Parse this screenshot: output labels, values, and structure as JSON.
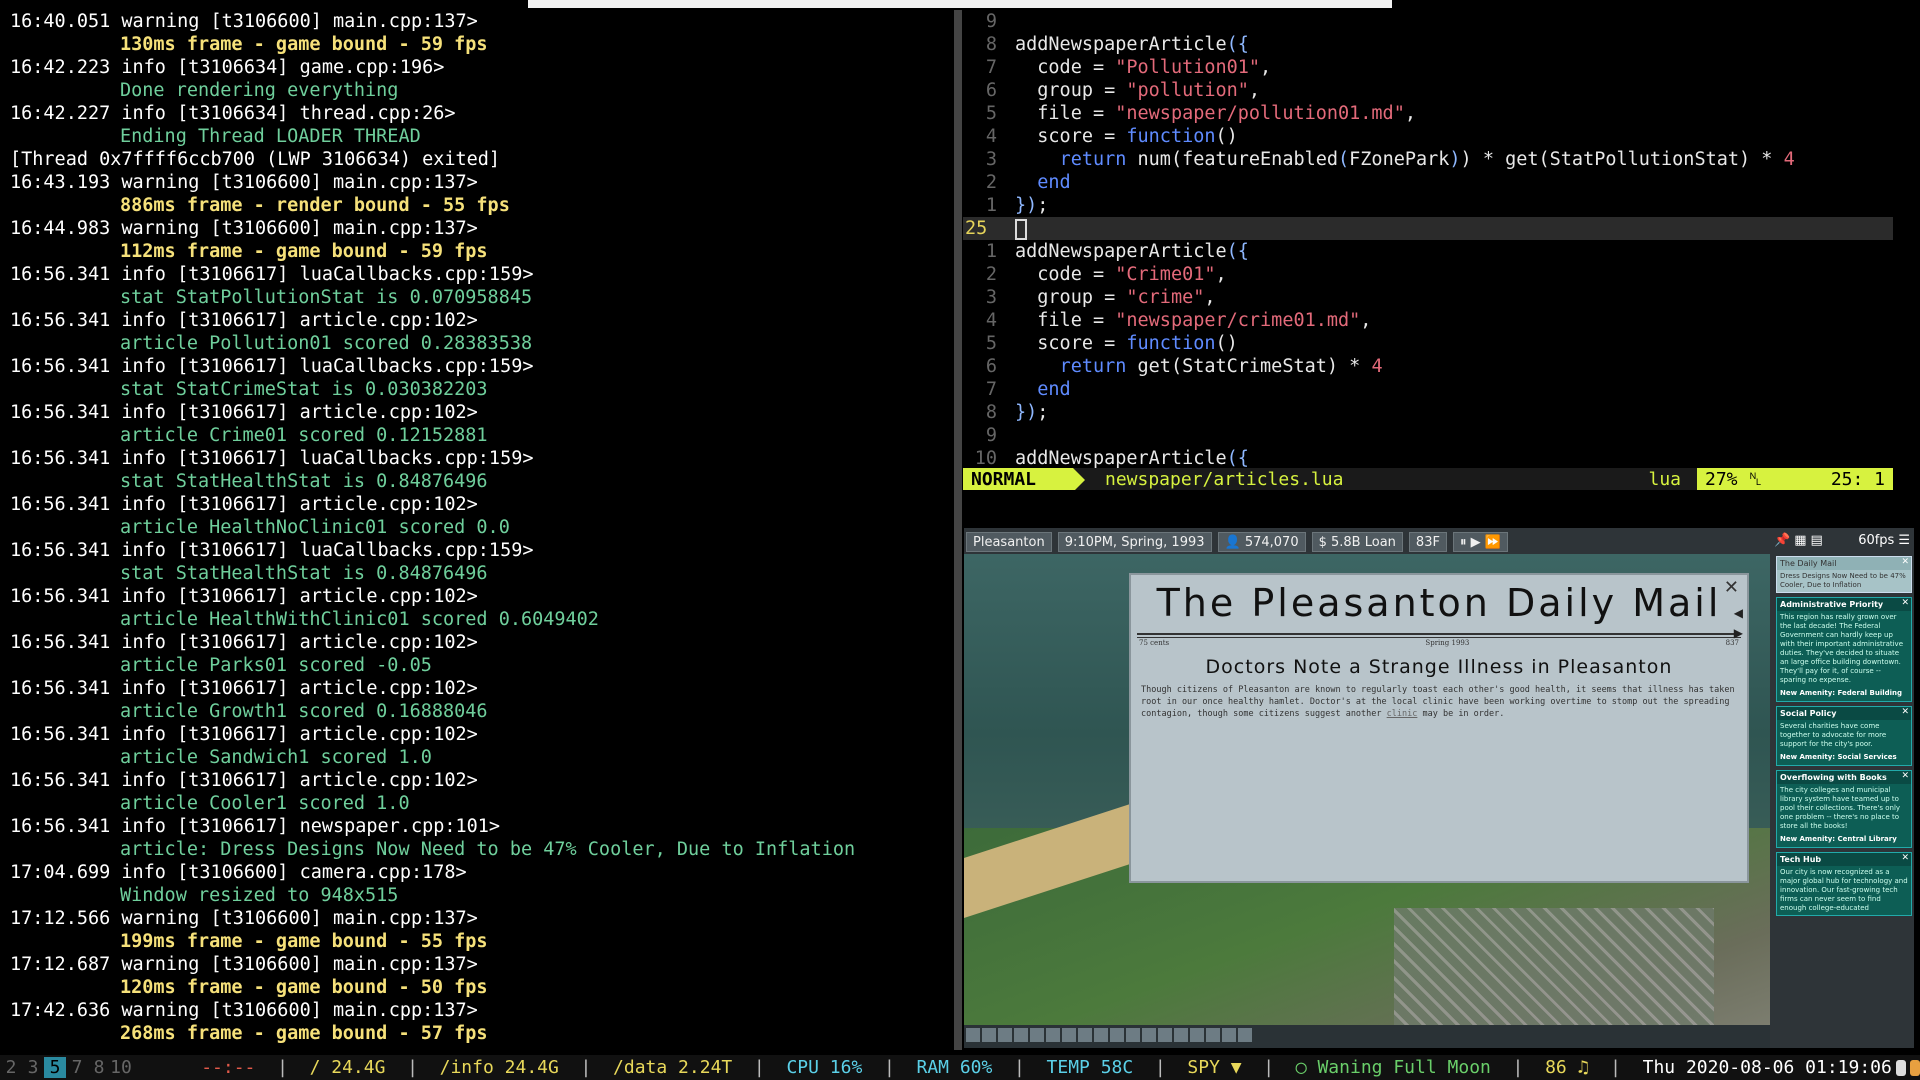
{
  "log": [
    {
      "kind": "head",
      "level": "warning",
      "text": "16:40.051 warning [t3106600] main.cpp:137>"
    },
    {
      "kind": "game",
      "text": "130ms frame - game bound - 59 fps"
    },
    {
      "kind": "head",
      "level": "info",
      "text": "16:42.223 info [t3106634] game.cpp:196>"
    },
    {
      "kind": "plain",
      "text": "Done rendering everything"
    },
    {
      "kind": "head",
      "level": "info",
      "text": "16:42.227 info [t3106634] thread.cpp:26>"
    },
    {
      "kind": "plain",
      "text": "Ending Thread LOADER THREAD"
    },
    {
      "kind": "thread",
      "text": "[Thread 0x7ffff6ccb700 (LWP 3106634) exited]"
    },
    {
      "kind": "head",
      "level": "warning",
      "text": "16:43.193 warning [t3106600] main.cpp:137>"
    },
    {
      "kind": "game",
      "text": "886ms frame - render bound - 55 fps"
    },
    {
      "kind": "head",
      "level": "warning",
      "text": "16:44.983 warning [t3106600] main.cpp:137>"
    },
    {
      "kind": "game",
      "text": "112ms frame - game bound - 59 fps"
    },
    {
      "kind": "head",
      "level": "info",
      "text": "16:56.341 info [t3106617] luaCallbacks.cpp:159>"
    },
    {
      "kind": "plain",
      "text": "stat StatPollutionStat is 0.070958845"
    },
    {
      "kind": "head",
      "level": "info",
      "text": "16:56.341 info [t3106617] article.cpp:102>"
    },
    {
      "kind": "plain",
      "text": "article Pollution01 scored 0.28383538"
    },
    {
      "kind": "head",
      "level": "info",
      "text": "16:56.341 info [t3106617] luaCallbacks.cpp:159>"
    },
    {
      "kind": "plain",
      "text": "stat StatCrimeStat is 0.030382203"
    },
    {
      "kind": "head",
      "level": "info",
      "text": "16:56.341 info [t3106617] article.cpp:102>"
    },
    {
      "kind": "plain",
      "text": "article Crime01 scored 0.12152881"
    },
    {
      "kind": "head",
      "level": "info",
      "text": "16:56.341 info [t3106617] luaCallbacks.cpp:159>"
    },
    {
      "kind": "plain",
      "text": "stat StatHealthStat is 0.84876496"
    },
    {
      "kind": "head",
      "level": "info",
      "text": "16:56.341 info [t3106617] article.cpp:102>"
    },
    {
      "kind": "plain",
      "text": "article HealthNoClinic01 scored 0.0"
    },
    {
      "kind": "head",
      "level": "info",
      "text": "16:56.341 info [t3106617] luaCallbacks.cpp:159>"
    },
    {
      "kind": "plain",
      "text": "stat StatHealthStat is 0.84876496"
    },
    {
      "kind": "head",
      "level": "info",
      "text": "16:56.341 info [t3106617] article.cpp:102>"
    },
    {
      "kind": "plain",
      "text": "article HealthWithClinic01 scored 0.6049402"
    },
    {
      "kind": "head",
      "level": "info",
      "text": "16:56.341 info [t3106617] article.cpp:102>"
    },
    {
      "kind": "plain",
      "text": "article Parks01 scored -0.05"
    },
    {
      "kind": "head",
      "level": "info",
      "text": "16:56.341 info [t3106617] article.cpp:102>"
    },
    {
      "kind": "plain",
      "text": "article Growth1 scored 0.16888046"
    },
    {
      "kind": "head",
      "level": "info",
      "text": "16:56.341 info [t3106617] article.cpp:102>"
    },
    {
      "kind": "plain",
      "text": "article Sandwich1 scored 1.0"
    },
    {
      "kind": "head",
      "level": "info",
      "text": "16:56.341 info [t3106617] article.cpp:102>"
    },
    {
      "kind": "plain",
      "text": "article Cooler1 scored 1.0"
    },
    {
      "kind": "head",
      "level": "info",
      "text": "16:56.341 info [t3106617] newspaper.cpp:101>"
    },
    {
      "kind": "plain",
      "text": "article: Dress Designs Now Need to be 47% Cooler, Due to Inflation"
    },
    {
      "kind": "head",
      "level": "info",
      "text": "17:04.699 info [t3106600] camera.cpp:178>"
    },
    {
      "kind": "plain",
      "text": "Window resized to 948x515"
    },
    {
      "kind": "head",
      "level": "warning",
      "text": "17:12.566 warning [t3106600] main.cpp:137>"
    },
    {
      "kind": "game",
      "text": "199ms frame - game bound - 55 fps"
    },
    {
      "kind": "head",
      "level": "warning",
      "text": "17:12.687 warning [t3106600] main.cpp:137>"
    },
    {
      "kind": "game",
      "text": "120ms frame - game bound - 50 fps"
    },
    {
      "kind": "head",
      "level": "warning",
      "text": "17:42.636 warning [t3106600] main.cpp:137>"
    },
    {
      "kind": "game",
      "text": "268ms frame - game bound - 57 fps"
    }
  ],
  "editor": {
    "lines": [
      {
        "n": "9",
        "html": ""
      },
      {
        "n": "8",
        "html": "addNewspaperArticle<span class='p'>({</span>"
      },
      {
        "n": "7",
        "html": "  code = <span class='s'>\"Pollution01\"</span>,"
      },
      {
        "n": "6",
        "html": "  group = <span class='s'>\"pollution\"</span>,"
      },
      {
        "n": "5",
        "html": "  file = <span class='s'>\"newspaper/pollution01.md\"</span>,"
      },
      {
        "n": "4",
        "html": "  score = <span class='k'>function</span>()"
      },
      {
        "n": "3",
        "html": "    <span class='k'>return</span> num(featureEnabled<span class='p'>(</span>FZonePark<span class='p'>)</span>) * get(StatPollutionStat) * <span class='n'>4</span>"
      },
      {
        "n": "2",
        "html": "  <span class='k'>end</span>"
      },
      {
        "n": "1",
        "html": "<span class='p'>})</span>;"
      },
      {
        "n": "25",
        "html": "<span class='cursorbox'></span>",
        "current": true
      },
      {
        "n": "1",
        "html": "addNewspaperArticle<span class='p'>({</span>"
      },
      {
        "n": "2",
        "html": "  code = <span class='s'>\"Crime01\"</span>,"
      },
      {
        "n": "3",
        "html": "  group = <span class='s'>\"crime\"</span>,"
      },
      {
        "n": "4",
        "html": "  file = <span class='s'>\"newspaper/crime01.md\"</span>,"
      },
      {
        "n": "5",
        "html": "  score = <span class='k'>function</span>()"
      },
      {
        "n": "6",
        "html": "    <span class='k'>return</span> get(StatCrimeStat) * <span class='n'>4</span>"
      },
      {
        "n": "7",
        "html": "  <span class='k'>end</span>"
      },
      {
        "n": "8",
        "html": "<span class='p'>})</span>;"
      },
      {
        "n": "9",
        "html": ""
      },
      {
        "n": "10",
        "html": "addNewspaperArticle<span class='p'>({</span>"
      }
    ],
    "status": {
      "mode": "NORMAL",
      "file": "newspaper/articles.lua",
      "filetype": "lua",
      "percent": "27% ␤",
      "position": "25:  1"
    }
  },
  "game": {
    "city": "Pleasanton",
    "time": "9:10PM, Spring,   1993",
    "population": "574,070",
    "money": "$  5.8B Loan",
    "temp": "83F",
    "fps": "60fps",
    "paper": {
      "masthead": "The Pleasanton Daily Mail",
      "left_date": "75 cents",
      "mid_date": "Spring 1993",
      "right_date": "837",
      "headline": "Doctors Note a Strange Illness in Pleasanton",
      "story": "Though citizens of Pleasanton are known to regularly toast each other's good health, it seems that illness has taken root in our once healthy hamlet. Doctor's at the local clinic have been working overtime to stomp out the spreading contagion, though some citizens suggest another",
      "story_link": "clinic",
      "story_end": " may be in order."
    },
    "sidebar": {
      "fps": "60fps",
      "cards": [
        {
          "title": "The Daily Mail",
          "body": "Dress Designs Now Need to be 47% Cooler, Due to Inflation",
          "foot": "",
          "light": true
        },
        {
          "title": "Administrative Priority",
          "body": "This region has really grown over the last decade! The Federal Government can hardly keep up with their important administrative duties. They've decided to situate an large office building downtown. They'll pay for it, of course -- sparing no expense.",
          "foot": "New Amenity: Federal Building",
          "light": false
        },
        {
          "title": "Social Policy",
          "body": "Several charities have come together to advocate for more support for the city's poor.",
          "foot": "New Amenity: Social Services",
          "light": false
        },
        {
          "title": "Overflowing with Books",
          "body": "The city colleges and municipal library system have teamed up to pool their collections. There's only one problem -- there's no place to store all the books!",
          "foot": "New Amenity: Central Library",
          "light": false
        },
        {
          "title": "Tech Hub",
          "body": "Our city is now recognized as a major global hub for technology and innovation. Our fast-growing tech firms can never seem to find enough college-educated",
          "foot": "",
          "light": false
        }
      ]
    }
  },
  "statusbar": {
    "workspaces": [
      "2",
      "3",
      "5",
      "7",
      "8",
      "10"
    ],
    "active": "5",
    "time_sep": "--:--",
    "disk_root": "/ 24.4G",
    "disk_info": "/info 24.4G",
    "disk_data": "/data 2.24T",
    "cpu": "CPU 16%",
    "ram": "RAM 60%",
    "temp": "TEMP 58C",
    "stock": "SPY ▼",
    "moon": "◯ Waning Full Moon",
    "volume": "86 ♫",
    "clock": "Thu 2020-08-06 01:19:06"
  }
}
